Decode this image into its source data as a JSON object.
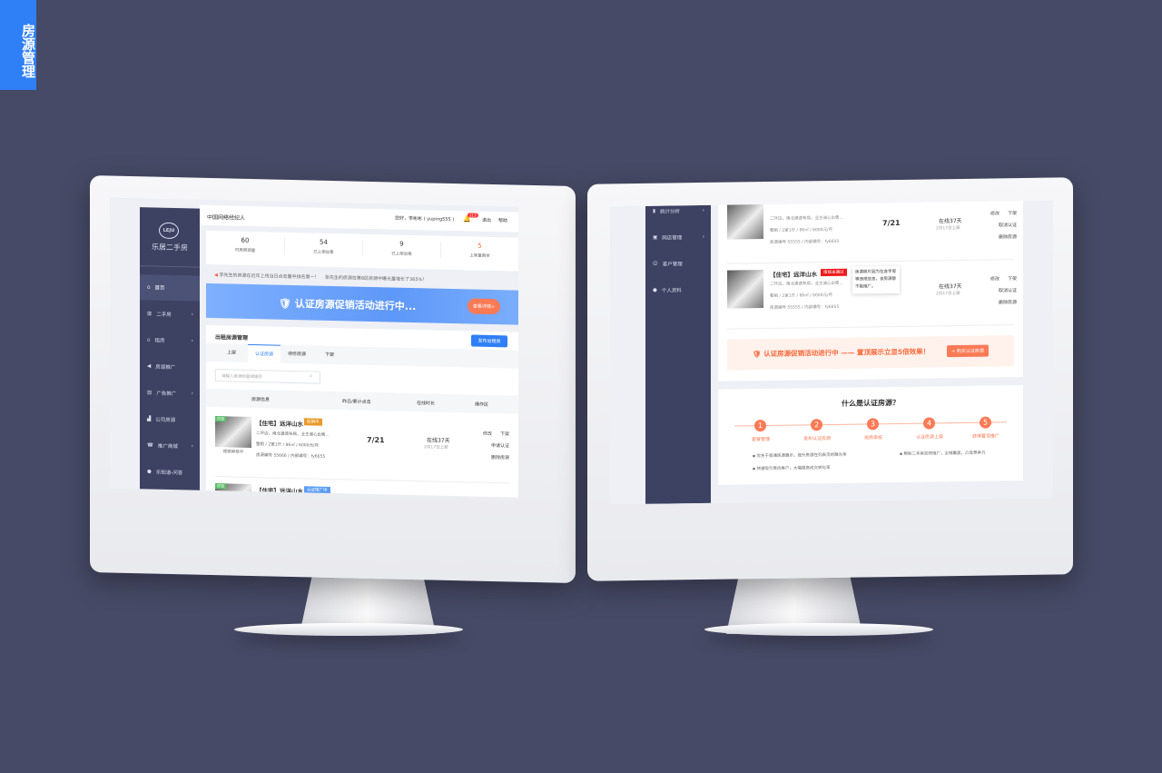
{
  "badge": {
    "text": "房源管理"
  },
  "left": {
    "logo": {
      "mark": "LEJU",
      "name": "乐居二手房"
    },
    "header": {
      "company": "中国网络经纪人",
      "greeting": "您好，李彬彬 ( yuping555 )",
      "notify_count": "213",
      "logout": "退出",
      "help": "帮助"
    },
    "stats": [
      {
        "value": "60",
        "label": "可用資源量",
        "color": "#333333"
      },
      {
        "value": "54",
        "label": "已上架出售",
        "color": "#333333"
      },
      {
        "value": "9",
        "label": "已上架出租",
        "color": "#333333"
      },
      {
        "value": "5",
        "label": "上架量剩余",
        "color": "#fb6a3d"
      }
    ],
    "notice": [
      "李先生的房源在近年上线当日点击量中排名第一！",
      "张先生的房源在第8区房源中曝光量增长了365%！"
    ],
    "banner": {
      "text": "认证房源促销活动进行中...",
      "button": "查看详情>"
    },
    "sidebar": [
      {
        "icon": "home-icon",
        "label": "首页"
      },
      {
        "icon": "building-icon",
        "label": "二手房",
        "arrow": true
      },
      {
        "icon": "house-icon",
        "label": "租房",
        "arrow": true
      },
      {
        "icon": "megaphone-icon",
        "label": "房源推广"
      },
      {
        "icon": "ad-icon",
        "label": "广告推广",
        "arrow": true
      },
      {
        "icon": "company-icon",
        "label": "公司房源"
      },
      {
        "icon": "shop-icon",
        "label": "推广商城",
        "arrow": true
      },
      {
        "icon": "qa-icon",
        "label": "乐知道-问答"
      },
      {
        "icon": "chart-icon",
        "label": "统计分析",
        "arrow": true
      }
    ],
    "section_title": "出租房源管理",
    "publish_button": "发布出租房",
    "tabs": [
      "上架",
      "认证房源",
      "待修房源",
      "下架"
    ],
    "search_placeholder": "请输入房源标题或编号",
    "columns": [
      "房源信息",
      "昨日/累计点击",
      "在线时长",
      "操作区"
    ],
    "listings": [
      {
        "title": "【住宅】远洋山水",
        "tag": "促销中",
        "tag_color": "#e99a2a",
        "thumb_tag": "优选",
        "desc": "二环边，南北通透布局，业主诚心出售...",
        "spec": "整租 / 2室1厅 / 86㎡ / 6000元/月",
        "code": "房源编号 55666 / 内部编号：fy6655",
        "clicks": "7/21",
        "online": "在线37天",
        "online_sub": "2月17日上架",
        "ops": [
          "修改",
          "下架",
          "申请认证",
          "删除房源"
        ],
        "thumb_caption": "视频审核中"
      },
      {
        "title": "【住宅】远洋山水",
        "tag": "认证推广中",
        "tag_color": "#5b9cf5",
        "thumb_tag": "优选"
      }
    ]
  },
  "right": {
    "sidebar": [
      {
        "icon": "chart-icon",
        "label": "统计分析",
        "arrow": true
      },
      {
        "icon": "store-icon",
        "label": "网店管理",
        "arrow": true
      },
      {
        "icon": "customer-icon",
        "label": "客户管理"
      },
      {
        "icon": "user-icon",
        "label": "个人资料"
      }
    ],
    "listings": [
      {
        "desc": "二环边，南北通透布局，业主诚心出售...",
        "spec": "整租 / 2室1厅 / 86㎡ / 6000元/月",
        "code": "房源编号 55555 / 内部编号：fy6655",
        "clicks": "7/21",
        "online": "在线37天",
        "online_sub": "2月17日上架",
        "ops": [
          "修改",
          "下架",
          "取消认证",
          "删除房源"
        ]
      },
      {
        "title": "【住宅】远洋山水",
        "tag": "审核未通过",
        "tag_color": "#f01a1a",
        "tooltip": "房源照片因为包含字母等违规信息，该房源暂不能推广。",
        "desc": "二环边，南北通透布局，业主诚心出售...",
        "spec": "整租 / 2室1厅 / 86㎡ / 6000元/月",
        "code": "房源编号 55555 / 内部编号：fy6655",
        "online": "在线37天",
        "online_sub": "2月17日上架",
        "ops": [
          "修改",
          "下架",
          "取消认证",
          "删除房源"
        ]
      }
    ],
    "promo": {
      "text": "认证房源促销活动进行中 —— 置顶展示立显5倍效果！",
      "button": "+ 购买认证房源"
    },
    "what": {
      "title": "什么是认证房源？",
      "steps": [
        "套餐管理",
        "发布认证房源",
        "资质审核",
        "认证房源上架",
        "获得置顶推广"
      ],
      "points": [
        "优先于普通房源展示，提升房源在列表页的曝光率",
        "快速吸引意向客户，大幅提高成交转化率",
        "帮助二手房加快推广，全城覆盖，凸显竞争力"
      ]
    }
  }
}
